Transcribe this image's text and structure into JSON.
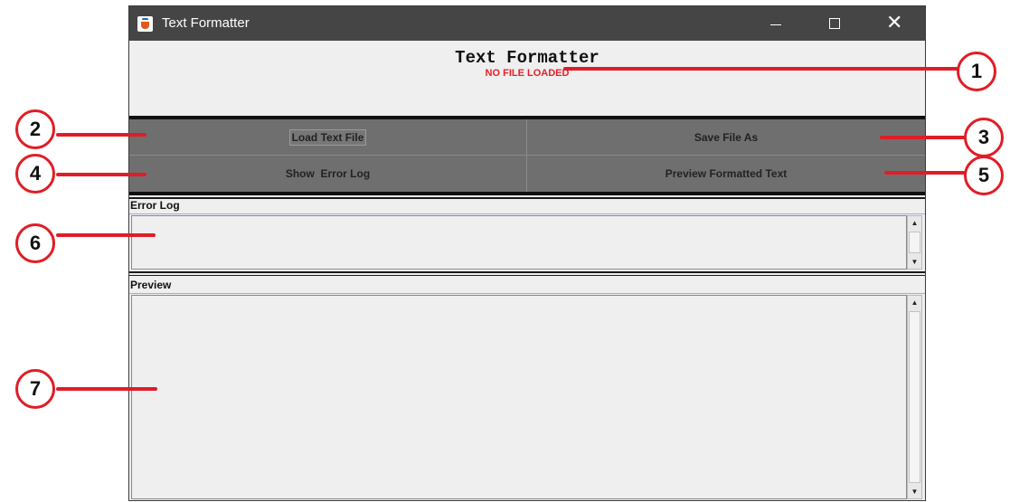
{
  "window": {
    "title": "Text Formatter",
    "controls": {
      "minimize": "minimize",
      "maximize": "maximize",
      "close": "✕"
    }
  },
  "header": {
    "heading": "Text Formatter",
    "file_status": "NO FILE LOADED"
  },
  "buttons": {
    "load": "Load Text File",
    "save": "Save File As",
    "error_log": "Show  Error Log",
    "preview": "Preview Formatted Text"
  },
  "panes": {
    "error_log": {
      "title": "Error Log",
      "content": ""
    },
    "preview": {
      "title": "Preview",
      "content": ""
    }
  },
  "scroll_glyphs": {
    "up": "▲",
    "down": "▼"
  },
  "annotations": [
    "1",
    "2",
    "3",
    "4",
    "5",
    "6",
    "7"
  ],
  "colors": {
    "titlebar": "#454545",
    "button_panel": "#6f6f6f",
    "status_text": "#e8202a",
    "annotation": "#e01d26"
  },
  "icons": {
    "app": "java-cup-icon",
    "minimize": "minimize-icon",
    "maximize": "maximize-icon",
    "close": "close-icon",
    "scroll_up": "arrow-up-icon",
    "scroll_down": "arrow-down-icon"
  }
}
